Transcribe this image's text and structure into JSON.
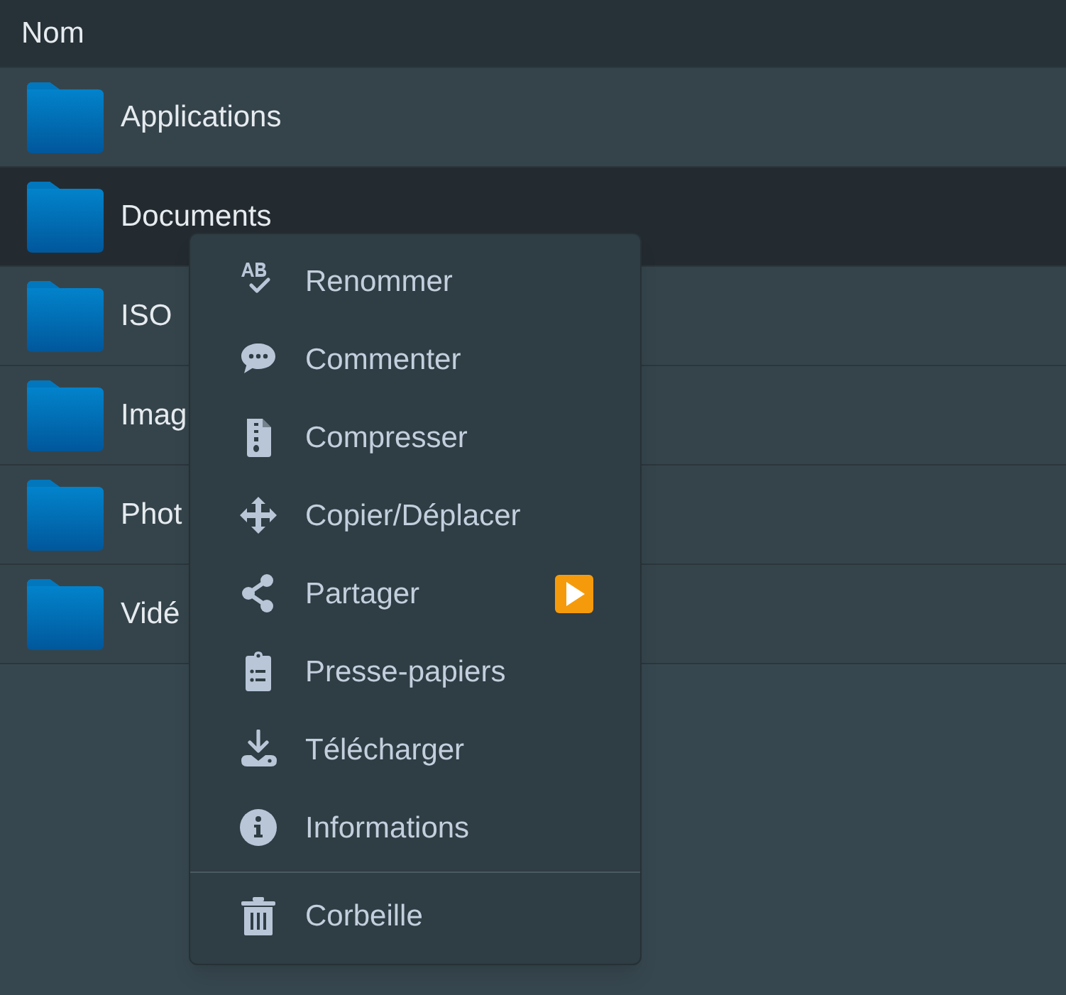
{
  "header": {
    "column_1": "Nom"
  },
  "rows": [
    {
      "name": "Applications",
      "selected": false
    },
    {
      "name": "Documents",
      "selected": true
    },
    {
      "name": "ISO",
      "selected": false
    },
    {
      "name": "Imag",
      "selected": false
    },
    {
      "name": "Phot",
      "selected": false
    },
    {
      "name": "Vidé",
      "selected": false
    }
  ],
  "context_menu": {
    "sections": [
      {
        "items": [
          {
            "label": "Renommer",
            "submenu": false
          },
          {
            "label": "Commenter",
            "submenu": false
          },
          {
            "label": "Compresser",
            "submenu": false
          },
          {
            "label": "Copier/Déplacer",
            "submenu": false
          },
          {
            "label": "Partager",
            "submenu": true
          },
          {
            "label": "Presse-papiers",
            "submenu": false
          },
          {
            "label": "Télécharger",
            "submenu": false
          },
          {
            "label": "Informations",
            "submenu": false
          }
        ]
      },
      {
        "items": [
          {
            "label": "Corbeille",
            "submenu": false
          }
        ]
      }
    ]
  }
}
